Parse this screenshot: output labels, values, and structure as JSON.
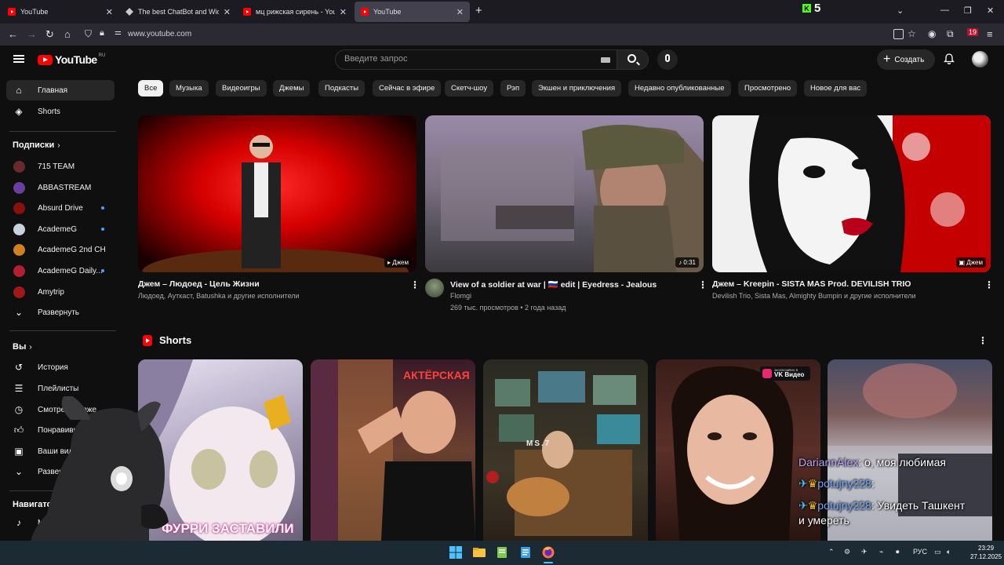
{
  "browser": {
    "tabs": [
      {
        "title": "YouTube",
        "favicon": "youtube-icon",
        "active": false
      },
      {
        "title": "The best ChatBot and Widgets f",
        "favicon": "diamond-icon",
        "active": false
      },
      {
        "title": "мц рижская сирень - YouTube",
        "favicon": "youtube-icon",
        "active": false
      },
      {
        "title": "YouTube",
        "favicon": "youtube-icon",
        "active": true
      }
    ],
    "kick_count": "5",
    "kick_letter": "K",
    "url": "www.youtube.com",
    "extension_badge": "19"
  },
  "youtube": {
    "logo_text": "YouTube",
    "logo_region": "RU",
    "search_placeholder": "Введите запрос",
    "create_label": "Создать"
  },
  "sidebar": {
    "main": [
      {
        "label": "Главная",
        "icon": "home-icon",
        "active": true
      },
      {
        "label": "Shorts",
        "icon": "shorts-icon",
        "active": false
      }
    ],
    "subscriptions_header": "Подписки",
    "subscriptions": [
      {
        "label": "715 TEAM",
        "new": false,
        "color": "#6a2a2a"
      },
      {
        "label": "ABBASTREAM",
        "new": false,
        "color": "#6a3fa0"
      },
      {
        "label": "Absurd Drive",
        "new": true,
        "color": "#8a1010"
      },
      {
        "label": "AcademeG",
        "new": true,
        "color": "#c9d2dc"
      },
      {
        "label": "AcademeG 2nd CH",
        "new": false,
        "color": "#d08020"
      },
      {
        "label": "AcademeG Daily...",
        "new": true,
        "color": "#b02030"
      },
      {
        "label": "Amytrip",
        "new": false,
        "color": "#a01818"
      }
    ],
    "expand_label": "Развернуть",
    "you_header": "Вы",
    "you_items": [
      {
        "label": "История",
        "icon": "history-icon"
      },
      {
        "label": "Плейлисты",
        "icon": "playlists-icon"
      },
      {
        "label": "Смотреть позже",
        "icon": "watch-later-icon"
      },
      {
        "label": "Понравившиеся",
        "icon": "like-icon"
      },
      {
        "label": "Ваши видео",
        "icon": "your-videos-icon"
      },
      {
        "label": "Развернуть",
        "icon": "chevron-down-icon"
      }
    ],
    "navigator_header": "Навигатор",
    "navigator_items": [
      {
        "label": "Музыка",
        "icon": "music-icon"
      }
    ]
  },
  "chips": [
    "Все",
    "Музыка",
    "Видеоигры",
    "Джемы",
    "Подкасты",
    "Сейчас в эфире",
    "Скетч-шоу",
    "Рэп",
    "Экшен и приключения",
    "Недавно опубликованные",
    "Просмотрено",
    "Новое для вас"
  ],
  "videos": [
    {
      "title": "Джем – Людоед - Цель Жизни",
      "meta1": "Людоед, Ауткаст, Batushka и другие исполнители",
      "meta2": "",
      "badge": "Джем"
    },
    {
      "title": "View of a soldier at war | 🇷🇺 edit | Eyedress - Jealous",
      "meta1": "Flomgi",
      "meta2": "269 тыс. просмотров • 2 года назад",
      "badge": "0:31"
    },
    {
      "title": "Джем – Kreepin - SISTA MAS Prod. DEVILISH TRIO",
      "meta1": "Devilish Trio, Sista Mas, Almighty Bumpin и другие исполнители",
      "meta2": "",
      "badge": "Джем"
    }
  ],
  "shorts": {
    "header": "Shorts",
    "items": [
      {
        "caption": "ФУРРИ ЗАСТАВИЛИ"
      },
      {
        "caption": "АКТЁРСКАЯ"
      },
      {
        "caption": "MS.7"
      },
      {
        "caption": "ЭКСКЛЮЗИВНО В VK Видео"
      },
      {
        "caption": ""
      }
    ],
    "vk_small": "эксклюзивно в",
    "vk_big": "VK Видео"
  },
  "chat": [
    {
      "user": "DariannAlex",
      "text": " о, моя любимая"
    },
    {
      "user": "potujny228",
      "text": ""
    },
    {
      "user": "potujny228",
      "text": " Увидеть Ташкент"
    },
    {
      "user": "",
      "text": "и умереть"
    }
  ],
  "taskbar": {
    "lang": "РУС",
    "time": "23:29",
    "date": "27.12.2025"
  }
}
